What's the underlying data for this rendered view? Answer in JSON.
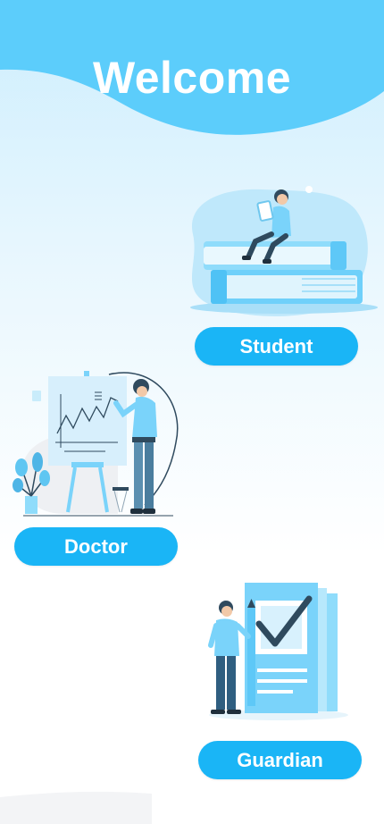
{
  "header": {
    "title": "Welcome"
  },
  "roles": {
    "student": {
      "label": "Student",
      "illustration": "student-reading-on-books"
    },
    "doctor": {
      "label": "Doctor",
      "illustration": "doctor-presenting-chart"
    },
    "guardian": {
      "label": "Guardian",
      "illustration": "guardian-with-checklist"
    }
  },
  "colors": {
    "header": "#5ccdfb",
    "button": "#1ab5f6",
    "button_text": "#ffffff",
    "illustration_primary": "#7ad3fa",
    "illustration_dark": "#2f4a5e"
  }
}
